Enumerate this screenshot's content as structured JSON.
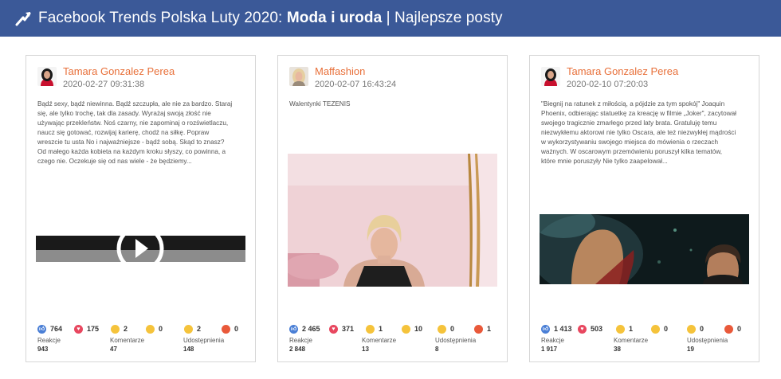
{
  "header": {
    "title_prefix": "Facebook Trends Polska Luty 2020: ",
    "title_bold": "Moda i uroda",
    "title_suffix": " | Najlepsze posty"
  },
  "colors": {
    "header_bg": "#3b5998",
    "author_name": "#e8703a",
    "like": "#4a7fd6",
    "love": "#e8475f",
    "haha": "#f5c33b",
    "angry": "#e9593a"
  },
  "icons": [
    "trend-arrow-icon",
    "like-icon",
    "love-icon",
    "haha-icon",
    "wow-icon",
    "sad-icon",
    "angry-icon",
    "play-icon"
  ],
  "labels": {
    "reactions": "Reakcje",
    "comments": "Komentarze",
    "shares": "Udostępnienia"
  },
  "posts": [
    {
      "author": "Tamara Gonzalez Perea",
      "date": "2020-02-27 09:31:38",
      "text": "Bądź sexy, bądź niewinna. Bądź szczupła, ale nie za bardzo. Staraj się, ale tylko trochę, tak dla zasady. Wyrażaj swoją złość nie używając przekleństw. Noś czarny, nie zapominaj o rozświetlaczu, naucz się gotować, rozwijaj karierę, chodź na siłkę. Popraw wreszcie tu usta No i najważniejsze - bądź sobą. Skąd to znasz? Od małego każda kobieta na każdym kroku słyszy, co powinna, a czego nie. Oczekuje się od nas wiele - że będziemy...",
      "like": "764",
      "love": "175",
      "haha": "2",
      "wow": "0",
      "sad": "2",
      "angry": "0",
      "reactions": "943",
      "comments": "47",
      "shares": "148"
    },
    {
      "author": "Maffashion",
      "date": "2020-02-07 16:43:24",
      "text": "Walentynki TEZENIS",
      "like": "2 465",
      "love": "371",
      "haha": "1",
      "wow": "10",
      "sad": "0",
      "angry": "1",
      "reactions": "2 848",
      "comments": "13",
      "shares": "8"
    },
    {
      "author": "Tamara Gonzalez Perea",
      "date": "2020-02-10 07:20:03",
      "text": "\"Biegnij na ratunek z miłością, a pójdzie za tym spokój\" Joaquin Phoenix, odbierając statuetkę za kreację w filmie „Joker\", zacytował swojego tragicznie zmarłego przed laty brata. Gratuluję temu niezwykłemu aktorowi nie tylko Oscara, ale też niezwykłej mądrości w wykorzystywaniu swojego miejsca do mówienia o rzeczach ważnych. W oscarowym przemówieniu poruszył kilka tematów, które mnie poruszyły Nie tylko zaapelował...",
      "like": "1 413",
      "love": "503",
      "haha": "1",
      "wow": "0",
      "sad": "0",
      "angry": "0",
      "reactions": "1 917",
      "comments": "38",
      "shares": "19"
    }
  ]
}
